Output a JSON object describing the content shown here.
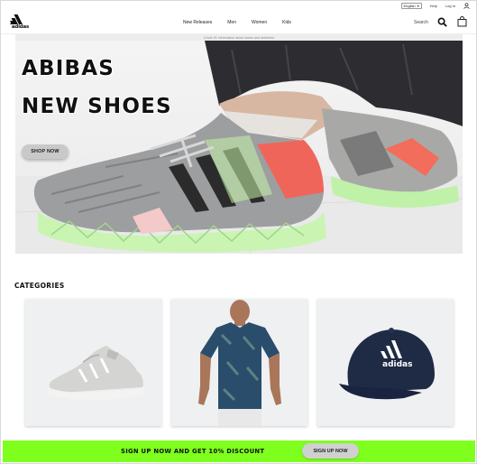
{
  "topbar": {
    "language": "English",
    "help": "Help",
    "login": "Log In"
  },
  "brand": {
    "logo_text": "adidas"
  },
  "nav": {
    "items": [
      {
        "label": "New Releases"
      },
      {
        "label": "Men"
      },
      {
        "label": "Women"
      },
      {
        "label": "Kids"
      }
    ],
    "search_placeholder": "Search"
  },
  "promo": {
    "text": "Covid-19: Information about stores and deliveries"
  },
  "hero": {
    "title_line1": "ABIBAS",
    "title_line2": "NEW SHOES",
    "cta": "SHOP NOW"
  },
  "categories": {
    "heading": "CATEGORIES",
    "items": [
      {
        "name": "shoes",
        "image_icon": "running-shoe-icon"
      },
      {
        "name": "clothing",
        "image_icon": "tshirt-icon"
      },
      {
        "name": "accessories",
        "image_icon": "cap-icon",
        "cap_text": "adidas"
      }
    ]
  },
  "signup": {
    "message": "SIGN UP NOW AND GET 10% DISCOUNT",
    "button": "SIGN UP NOW"
  },
  "colors": {
    "accent_green": "#7fff1e",
    "button_gray": "#c9c9c9",
    "card_bg": "#eef0f2"
  }
}
